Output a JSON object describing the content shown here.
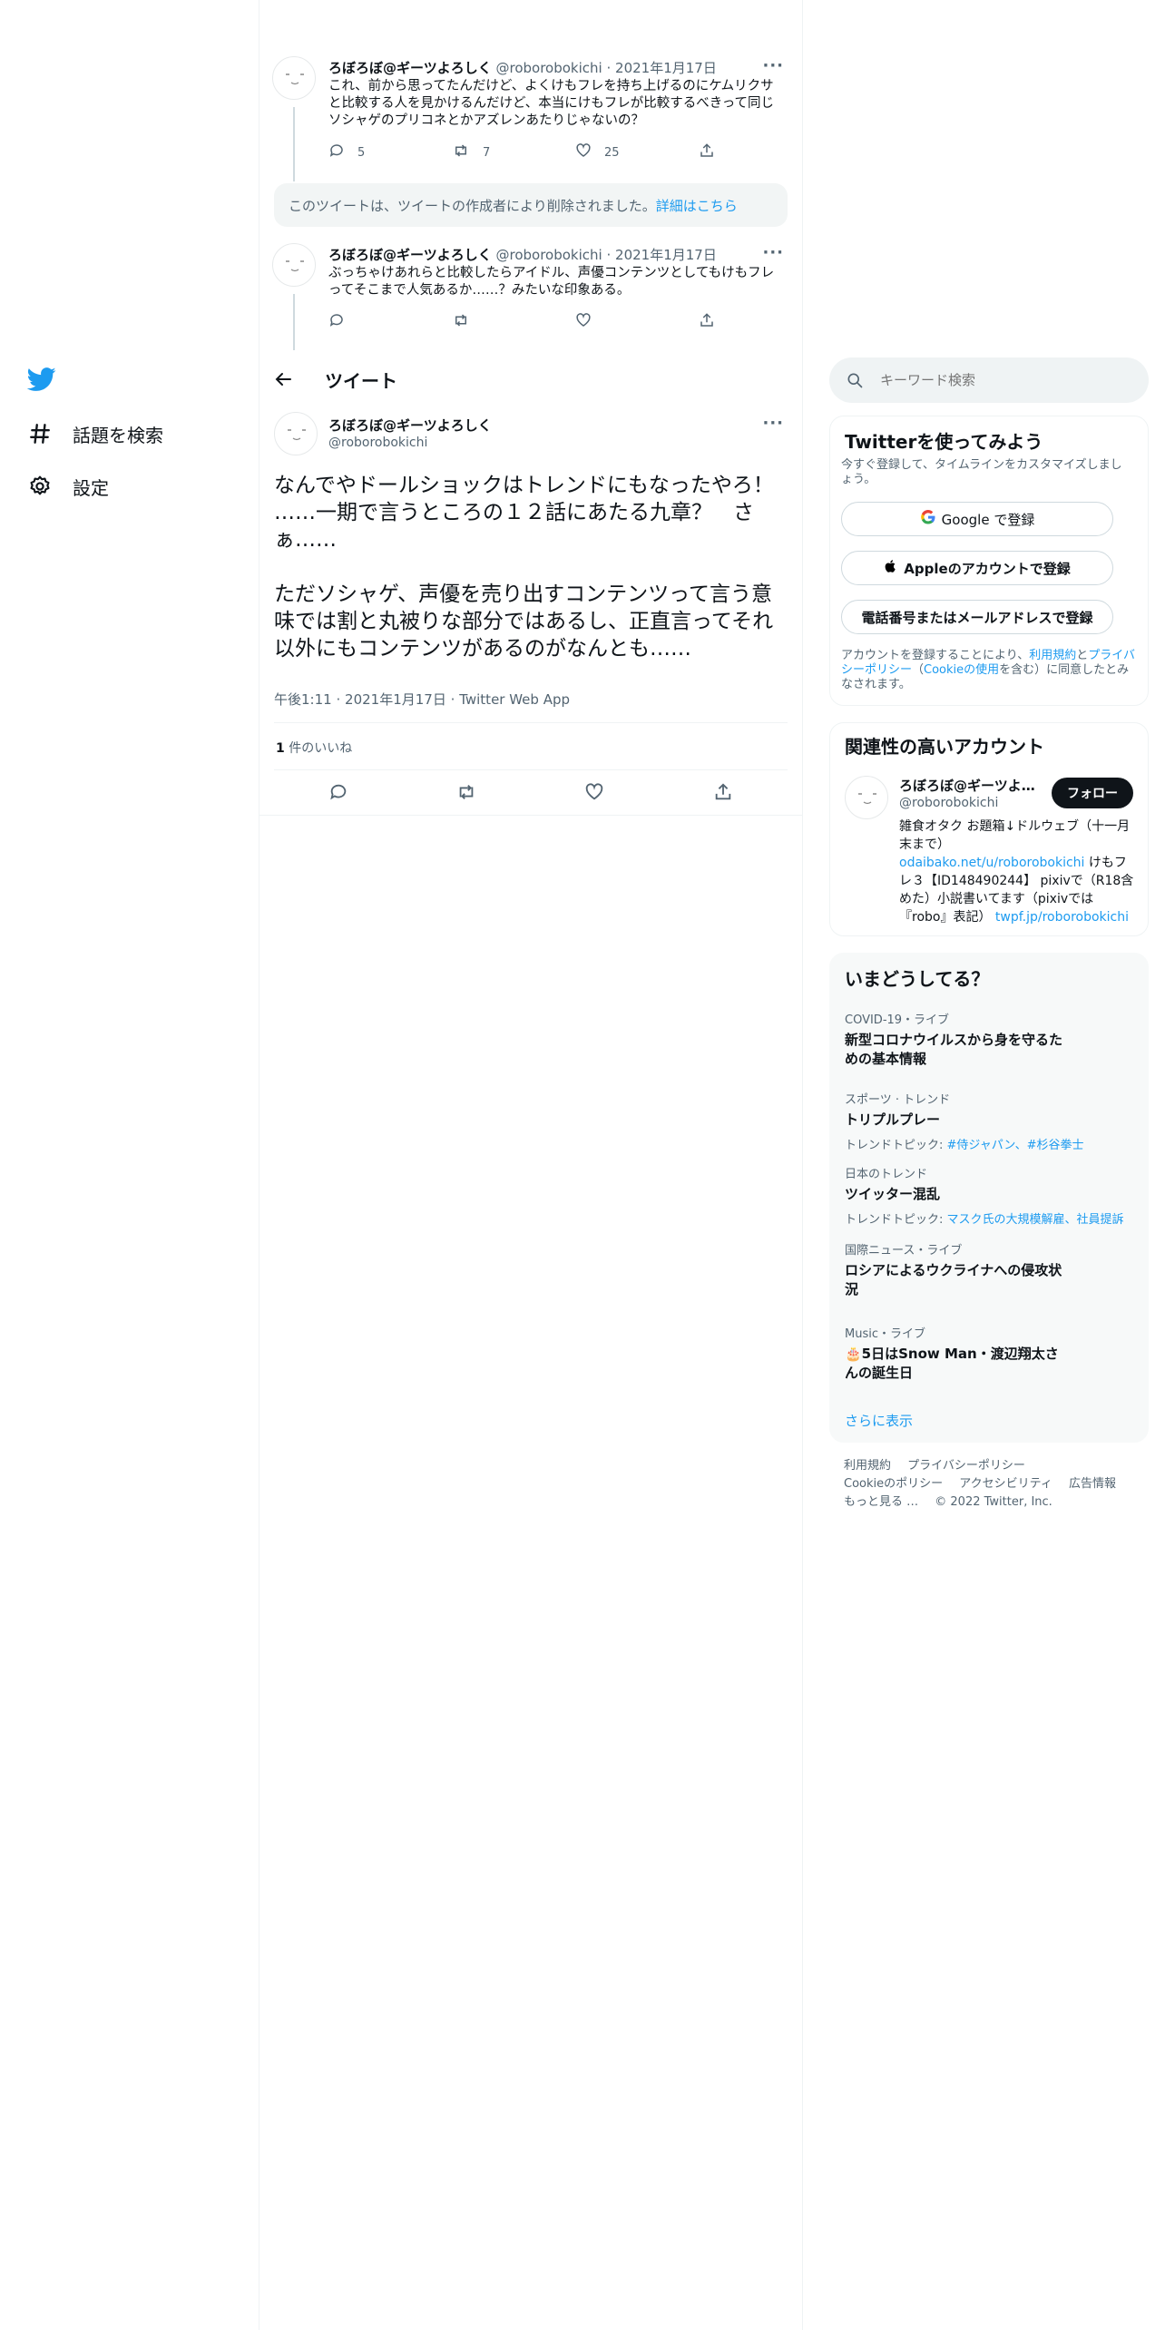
{
  "nav": {
    "logo_icon": "twitter-bird-icon",
    "explore_label": "話題を検索",
    "settings_label": "設定"
  },
  "thread": {
    "tweet1": {
      "name": "ろぼろぼ@ギーツよろしく",
      "handle": "@roborobokichi",
      "sep": "·",
      "date": "2021年1月17日",
      "text": "これ、前から思ってたんだけど、よくけもフレを持ち上げるのにケムリクサと比較する人を見かけるんだけど、本当にけもフレが比較するべきって同じソシャゲのプリコネとかアズレンあたりじゃないの？",
      "replies": "5",
      "retweets": "7",
      "likes": "25"
    },
    "deleted_notice": "このツイートは、ツイートの作成者により削除されました。",
    "deleted_link": "詳細はこちら",
    "tweet2": {
      "name": "ろぼろぼ@ギーツよろしく",
      "handle": "@roborobokichi",
      "sep": "·",
      "date": "2021年1月17日",
      "text": "ぶっちゃけあれらと比較したらアイドル、声優コンテンツとしてもけもフレってそこまで人気あるか……？みたいな印象ある。"
    }
  },
  "header": {
    "back_icon": "arrow-left-icon",
    "title": "ツイート"
  },
  "main_tweet": {
    "name": "ろぼろぼ@ギーツよろしく",
    "handle": "@roborobokichi",
    "text": "なんでやドールショックはトレンドにもなったやろ！\n……一期で言うところの１２話にあたる九章？　さぁ……\n\nただソシャゲ、声優を売り出すコンテンツって言う意味では割と丸被りな部分ではあるし、正直言ってそれ以外にもコンテンツがあるのがなんとも……",
    "time": "午後1:11",
    "sep1": "·",
    "date": "2021年1月17日",
    "sep2": "·",
    "source": "Twitter Web App",
    "likes_count": "1",
    "likes_label": " 件のいいね"
  },
  "search": {
    "placeholder": "キーワード検索"
  },
  "signup": {
    "title": "Twitterを使ってみよう",
    "desc": "今すぐ登録して、タイムラインをカスタマイズしましょう。",
    "google": "Google で登録",
    "apple": "Appleのアカウントで登録",
    "phone": "電話番号またはメールアドレスで登録",
    "legal_1": "アカウントを登録することにより、",
    "terms": "利用規約",
    "legal_2": "と",
    "privacy": "プライバシーポリシー",
    "legal_3": "（",
    "cookie": "Cookieの使用",
    "legal_4": "を含む）に同意したとみなされます。"
  },
  "related": {
    "title": "関連性の高いアカウント",
    "name": "ろぼろぼ@ギーツよ…",
    "handle": "@roborobokichi",
    "follow": "フォロー",
    "bio_1": "雑食オタク お題箱↓ドルウェブ（十一月末まで）",
    "bio_link1": "odaibako.net/u/roborobokichi",
    "bio_2": " けもフレ３【ID148490244】 pixivで（R18含めた）小説書いてます（pixivでは『robo』表記） ",
    "bio_link2": "twpf.jp/roborobokichi"
  },
  "trends": {
    "title": "いまどうしてる？",
    "items": [
      {
        "category": "COVID-19・ライブ",
        "title": "新型コロナウイルスから身を守るための基本情報",
        "topics_label": "",
        "topics": ""
      },
      {
        "category": "スポーツ · トレンド",
        "title": "トリプルプレー",
        "topics_label": "トレンドトピック: ",
        "topics": "#侍ジャパン、#杉谷拳士"
      },
      {
        "category": "日本のトレンド",
        "title": "ツイッター混乱",
        "topics_label": "トレンドトピック: ",
        "topics": "マスク氏の大規模解雇、社員提訴"
      },
      {
        "category": "国際ニュース・ライブ",
        "title": "ロシアによるウクライナへの侵攻状況",
        "topics_label": "",
        "topics": ""
      },
      {
        "category": "Music・ライブ",
        "title": "🎂5日はSnow Man・渡辺翔太さんの誕生日",
        "topics_label": "",
        "topics": ""
      }
    ],
    "show_more": "さらに表示"
  },
  "footer": {
    "terms": "利用規約",
    "privacy": "プライバシーポリシー",
    "cookie": "Cookieのポリシー",
    "accessibility": "アクセシビリティ",
    "ads": "広告情報",
    "more": "もっと見る …",
    "copyright": "© 2022 Twitter, Inc."
  },
  "colors": {
    "accent": "#1d9bf0",
    "text": "#0f1419",
    "muted": "#536471"
  }
}
